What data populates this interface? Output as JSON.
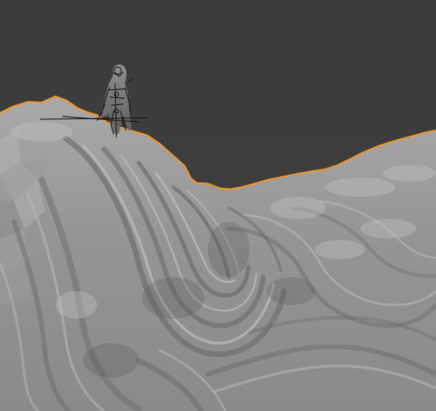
{
  "viewport": {
    "background_color": "#3d3d3d",
    "mesh_base_color": "#8f8f8f",
    "mesh_light_color": "#b4b4b4",
    "mesh_shadow_color": "#6a6a6a",
    "selection_outline_color": "#f0952a",
    "rig_color": "#141414",
    "selected_object": "terrain-mesh",
    "character_present": true
  }
}
